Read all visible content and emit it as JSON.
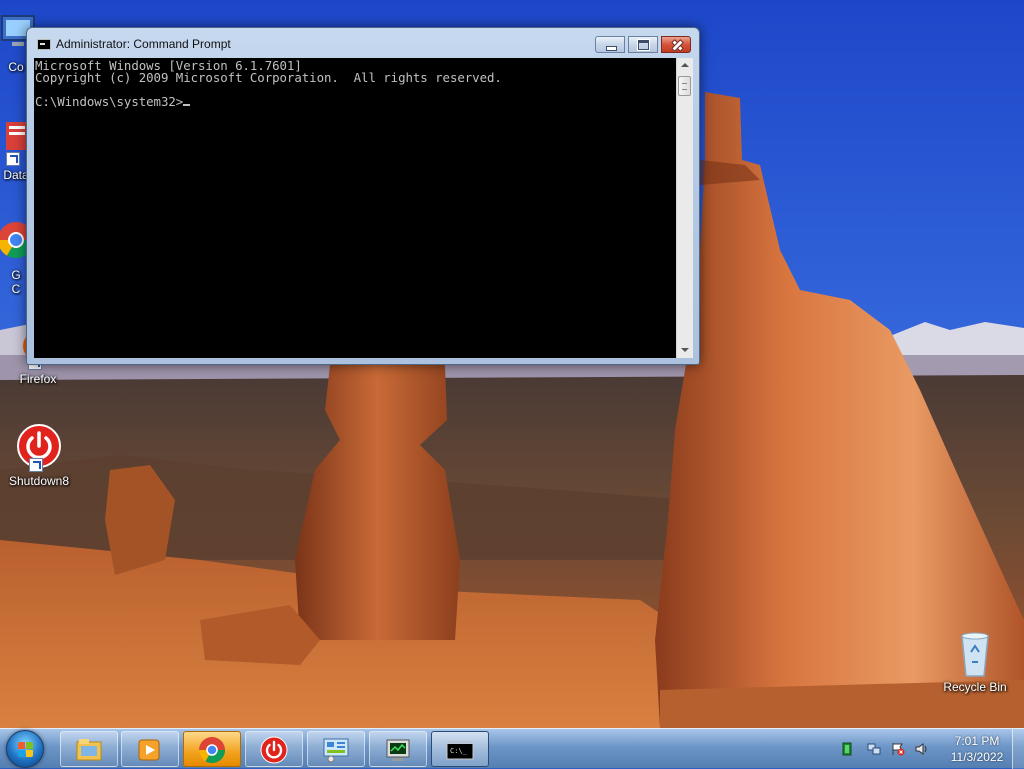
{
  "desktop": {
    "icons": [
      {
        "label": "Co"
      },
      {
        "label": "Data"
      },
      {
        "label": "G\nC"
      },
      {
        "label": "Firefox"
      },
      {
        "label": "Shutdown8"
      },
      {
        "label": "Recycle Bin"
      }
    ]
  },
  "cmd_window": {
    "title": "Administrator: Command Prompt",
    "console_lines": [
      "Microsoft Windows [Version 6.1.7601]",
      "Copyright (c) 2009 Microsoft Corporation.  All rights reserved.",
      "",
      "C:\\Windows\\system32>"
    ]
  },
  "taskbar": {
    "apps": [
      {
        "icon": "windows-explorer-icon"
      },
      {
        "icon": "media-player-icon"
      },
      {
        "icon": "chrome-icon",
        "state": "active"
      },
      {
        "icon": "shutdown-icon"
      },
      {
        "icon": "control-panel-icon"
      },
      {
        "icon": "task-manager-icon"
      },
      {
        "icon": "command-prompt-icon",
        "state": "running"
      }
    ],
    "clock": {
      "time": "7:01 PM",
      "date": "11/3/2022"
    }
  },
  "colors": {
    "console_bg": "#000000",
    "console_text": "#c0c0c0",
    "active_task": "#f2a21e"
  }
}
